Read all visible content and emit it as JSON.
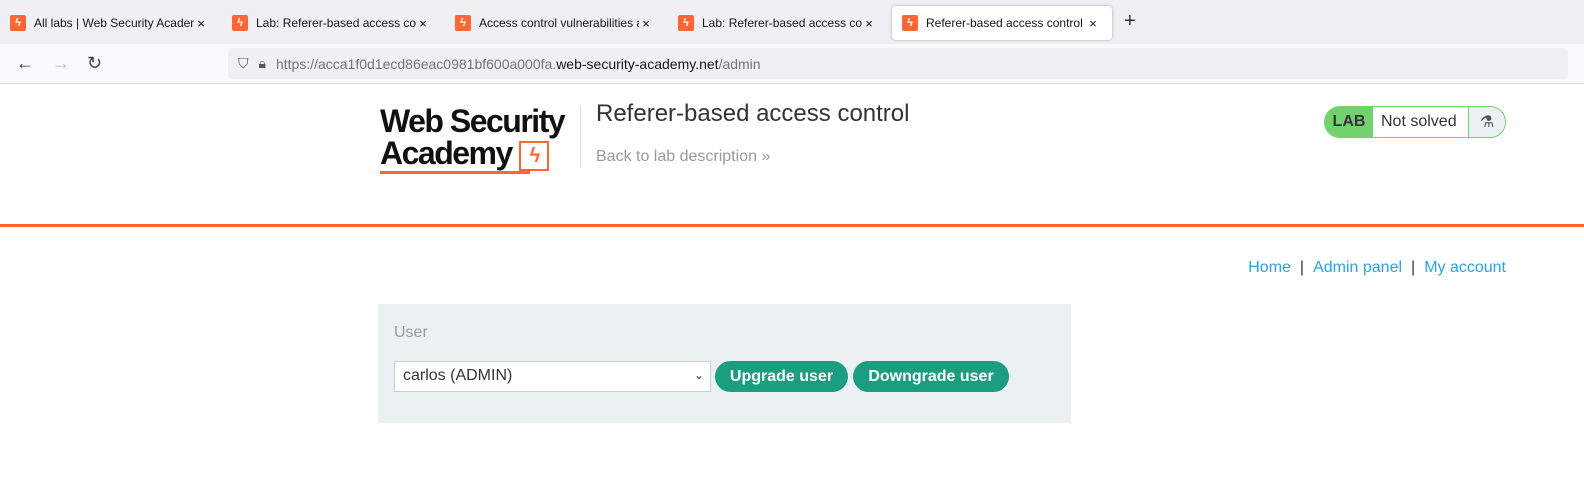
{
  "browser": {
    "tabs": [
      {
        "title": "All labs | Web Security Academy"
      },
      {
        "title": "Lab: Referer-based access control"
      },
      {
        "title": "Access control vulnerabilities and"
      },
      {
        "title": "Lab: Referer-based access control"
      },
      {
        "title": "Referer-based access control",
        "active": true
      }
    ],
    "new_tab": "+",
    "url_prefix": "https://acca1f0d1ecd86eac0981bf600a000fa.",
    "url_host": "web-security-academy.net",
    "url_path": "/admin"
  },
  "header": {
    "logo_line1": "Web Security",
    "logo_line2": "Academy",
    "lab_title": "Referer-based access control",
    "back_link": "Back to lab description",
    "back_chevron": "»",
    "badge_label": "LAB",
    "badge_status": "Not solved",
    "accent": "#ff6633"
  },
  "nav": {
    "home": "Home",
    "admin": "Admin panel",
    "account": "My account",
    "sep": "|"
  },
  "form": {
    "label": "User",
    "selected": "carlos (ADMIN)",
    "upgrade": "Upgrade user",
    "downgrade": "Downgrade user"
  }
}
